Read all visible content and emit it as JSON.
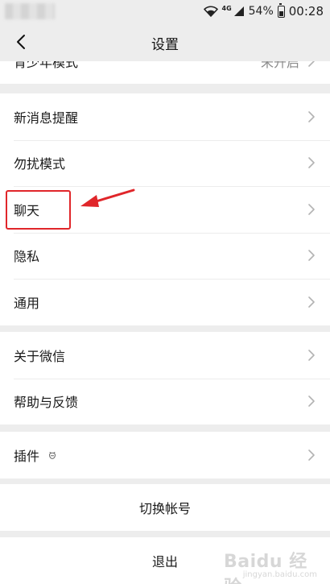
{
  "status_bar": {
    "network": "4G",
    "battery": "54%",
    "time": "00:28"
  },
  "nav": {
    "title": "设置"
  },
  "sections": {
    "top": {
      "items": [
        {
          "label": "青少年模式",
          "value": "未开启"
        }
      ]
    },
    "notifications": {
      "items": [
        {
          "label": "新消息提醒"
        },
        {
          "label": "勿扰模式"
        },
        {
          "label": "聊天"
        },
        {
          "label": "隐私"
        },
        {
          "label": "通用"
        }
      ]
    },
    "about": {
      "items": [
        {
          "label": "关于微信"
        },
        {
          "label": "帮助与反馈"
        }
      ]
    },
    "plugins": {
      "items": [
        {
          "label": "插件"
        }
      ]
    }
  },
  "actions": {
    "switch_account": "切换帐号",
    "logout": "退出"
  },
  "watermark": {
    "text": "Baidu 经验",
    "sub": "jingyan.baidu.com"
  },
  "colors": {
    "background": "#ededed",
    "card": "#ffffff",
    "annotation": "#e0262a"
  }
}
